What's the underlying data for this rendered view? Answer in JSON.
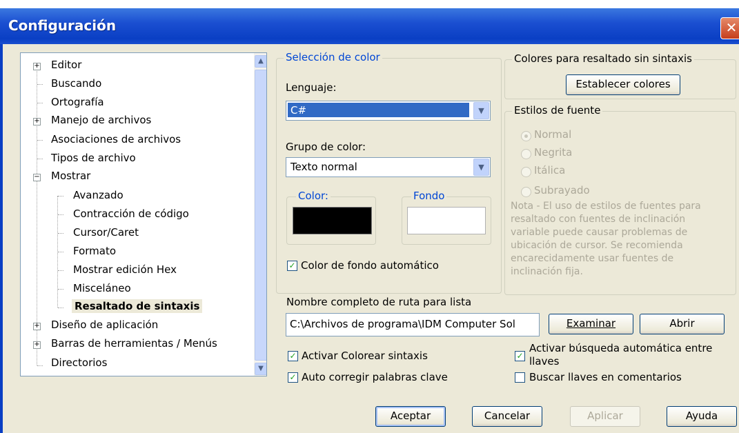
{
  "window": {
    "title": "Configuración",
    "close_glyph": "✕"
  },
  "tree": {
    "items": [
      {
        "label": "Editor",
        "expander": "+"
      },
      {
        "label": "Buscando"
      },
      {
        "label": "Ortografía"
      },
      {
        "label": "Manejo de archivos",
        "expander": "+"
      },
      {
        "label": "Asociaciones de archivos"
      },
      {
        "label": "Tipos de archivo"
      },
      {
        "label": "Mostrar",
        "expander": "−"
      },
      {
        "label": "Avanzado"
      },
      {
        "label": "Contracción de código"
      },
      {
        "label": "Cursor/Caret"
      },
      {
        "label": "Formato"
      },
      {
        "label": "Mostrar edición Hex"
      },
      {
        "label": "Misceláneo"
      },
      {
        "label": "Resaltado de sintaxis",
        "selected": true
      },
      {
        "label": "Diseño de aplicación",
        "expander": "+"
      },
      {
        "label": "Barras de herramientas / Menús",
        "expander": "+"
      },
      {
        "label": "Directorios"
      }
    ]
  },
  "color_selection": {
    "group_label": "Selección de color",
    "language_label": "Lenguaje:",
    "language_value": "C#",
    "color_group_label": "Grupo de color:",
    "color_group_value": "Texto normal",
    "color_label": "Color:",
    "color_value": "#000000",
    "background_label": "Fondo",
    "background_value": "#ffffff",
    "auto_bg_label": "Color de fondo automático",
    "auto_bg_checked": true
  },
  "no_syntax": {
    "group_label": "Colores para resaltado sin sintaxis",
    "set_colors_button": "Establecer colores"
  },
  "font_styles": {
    "group_label": "Estilos de fuente",
    "options": [
      "Normal",
      "Negrita",
      "Itálica",
      "Subrayado"
    ],
    "selected": "Normal",
    "note_lines": [
      "Nota - El uso de estilos de fuentes para",
      "resaltado con fuentes de inclinación",
      "variable puede causar problemas de",
      "ubicación de cursor.  Se recomienda",
      "encarecidamente usar fuentes de",
      "inclinación fija."
    ]
  },
  "path": {
    "label": "Nombre completo de ruta para lista",
    "value": "C:\\Archivos de programa\\IDM Computer Sol",
    "browse_button": "Examinar",
    "open_button": "Abrir"
  },
  "options": {
    "enable_syntax": {
      "label": "Activar Colorear sintaxis",
      "checked": true
    },
    "auto_correct": {
      "label": "Auto corregir palabras clave",
      "checked": true
    },
    "auto_brace_line1": "Activar búsqueda automática entre",
    "auto_brace_line2": "llaves",
    "auto_brace_checked": true,
    "brace_in_comments": {
      "label": "Buscar llaves en comentarios",
      "checked": false
    }
  },
  "buttons": {
    "ok": "Aceptar",
    "cancel": "Cancelar",
    "apply": "Aplicar",
    "help": "Ayuda"
  },
  "colors": {
    "title_bar": "#0a3fc4",
    "dialog_bg": "#ece9d8",
    "selection": "#316ac5",
    "group_label": "#0046d5"
  }
}
